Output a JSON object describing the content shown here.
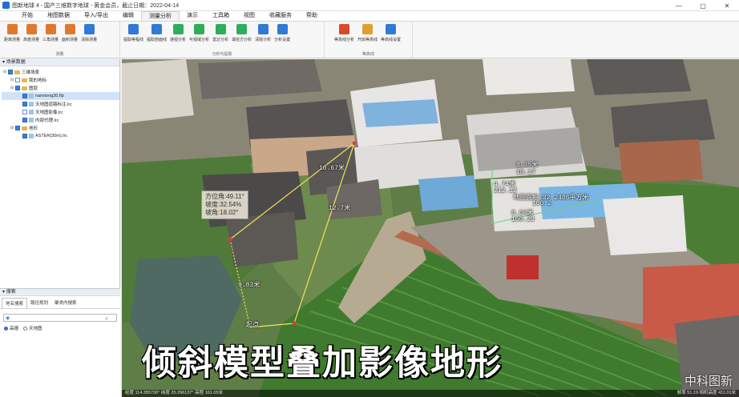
{
  "window": {
    "title": "图新地球 4 - 国产三维数字地球 - 黄金会员，截止日期：2022-04-14",
    "controls": [
      "—",
      "▢",
      "✕"
    ]
  },
  "menu": {
    "items": [
      "开始",
      "地图数据",
      "导入/导出",
      "编辑",
      "测量分析",
      "演示",
      "工具箱",
      "视图",
      "收藏服务",
      "帮助"
    ],
    "active_index": 4
  },
  "ribbon": {
    "groups": [
      {
        "name": "测量",
        "tools": [
          {
            "label": "距离测量",
            "icon": "ruler-icon",
            "color": "#e0782e"
          },
          {
            "label": "高度测量",
            "icon": "height-icon",
            "color": "#e0782e"
          },
          {
            "label": "三角测量",
            "icon": "triangle-icon",
            "color": "#e0782e"
          },
          {
            "label": "面积测量",
            "icon": "area-icon",
            "color": "#e0782e"
          },
          {
            "label": "清除测量",
            "icon": "eraser-icon",
            "color": "#2f7ad8"
          }
        ]
      },
      {
        "name": "分析与提取",
        "tools": [
          {
            "label": "提取等程线",
            "icon": "contour-icon",
            "color": "#2f7ad8"
          },
          {
            "label": "提取剖面线",
            "icon": "profile-icon",
            "color": "#2f7ad8"
          },
          {
            "label": "通视分析",
            "icon": "line-of-sight-icon",
            "color": "#2fae5a"
          },
          {
            "label": "可视域分析",
            "icon": "viewshed-icon",
            "color": "#2fae5a"
          },
          {
            "label": "雷达分析",
            "icon": "radar-icon",
            "color": "#2fae5a"
          },
          {
            "label": "填挖方分析",
            "icon": "cut-fill-icon",
            "color": "#2fae5a"
          },
          {
            "label": "清除分析",
            "icon": "eraser-icon",
            "color": "#2f7ad8"
          },
          {
            "label": "分析设置",
            "icon": "gear-icon",
            "color": "#2f7ad8"
          }
        ]
      },
      {
        "name": "等高线",
        "tools": [
          {
            "label": "等高线分析",
            "icon": "contour-analysis-icon",
            "color": "#d84a2a"
          },
          {
            "label": "开启等高线",
            "icon": "contour-on-icon",
            "color": "#e0a02e"
          },
          {
            "label": "等高线设置",
            "icon": "gear-icon",
            "color": "#2f7ad8"
          }
        ]
      }
    ]
  },
  "scene_panel": {
    "header": "场景数据",
    "tree": [
      {
        "label": "三维场景",
        "level": 0,
        "checked": true,
        "kind": "folder"
      },
      {
        "label": "我的地标",
        "level": 1,
        "checked": false,
        "kind": "folder"
      },
      {
        "label": "图层",
        "level": 1,
        "checked": true,
        "kind": "folder"
      },
      {
        "label": "nanxiong30.flp",
        "level": 2,
        "checked": true,
        "kind": "doc",
        "selected": true
      },
      {
        "label": "天地图道路标注.lrc",
        "level": 2,
        "checked": true,
        "kind": "doc"
      },
      {
        "label": "天地图影像.lrc",
        "level": 2,
        "checked": false,
        "kind": "doc"
      },
      {
        "label": "内部代理.lrc",
        "level": 2,
        "checked": true,
        "kind": "doc"
      },
      {
        "label": "地形",
        "level": 1,
        "checked": true,
        "kind": "folder"
      },
      {
        "label": "ASTER(30m).lrc",
        "level": 2,
        "checked": true,
        "kind": "doc"
      }
    ]
  },
  "search_panel": {
    "header": "搜索",
    "tabs": [
      "地名搜索",
      "路径规划",
      "聚类内搜索"
    ],
    "input_value": "",
    "radios": [
      {
        "label": "高德",
        "checked": true
      },
      {
        "label": "天地图",
        "checked": false
      }
    ]
  },
  "viewport": {
    "caption": "倾斜模型叠加影像地形",
    "watermark": "中科图新",
    "info_box": [
      "方位角:49.11°",
      "坡度:32.54%",
      "坡角:18.02°"
    ],
    "measurements": [
      {
        "text": "10.67米"
      },
      {
        "text": "12.7米"
      },
      {
        "text": "9.83米"
      },
      {
        "text": "起点"
      },
      {
        "text": "8.35米"
      },
      {
        "text": "18.17"
      },
      {
        "text": "4.74米"
      },
      {
        "text": "212.12"
      },
      {
        "text": "地面面积:32 2486平方米"
      },
      {
        "text": "8.66米"
      },
      {
        "text": "160.23"
      },
      {
        "text": "100.2"
      }
    ],
    "status": "经度 114.355730°   纬度 25.296137°   高程 161.05米",
    "status_right": "帧率 51.19   相机高度 411.01米"
  }
}
